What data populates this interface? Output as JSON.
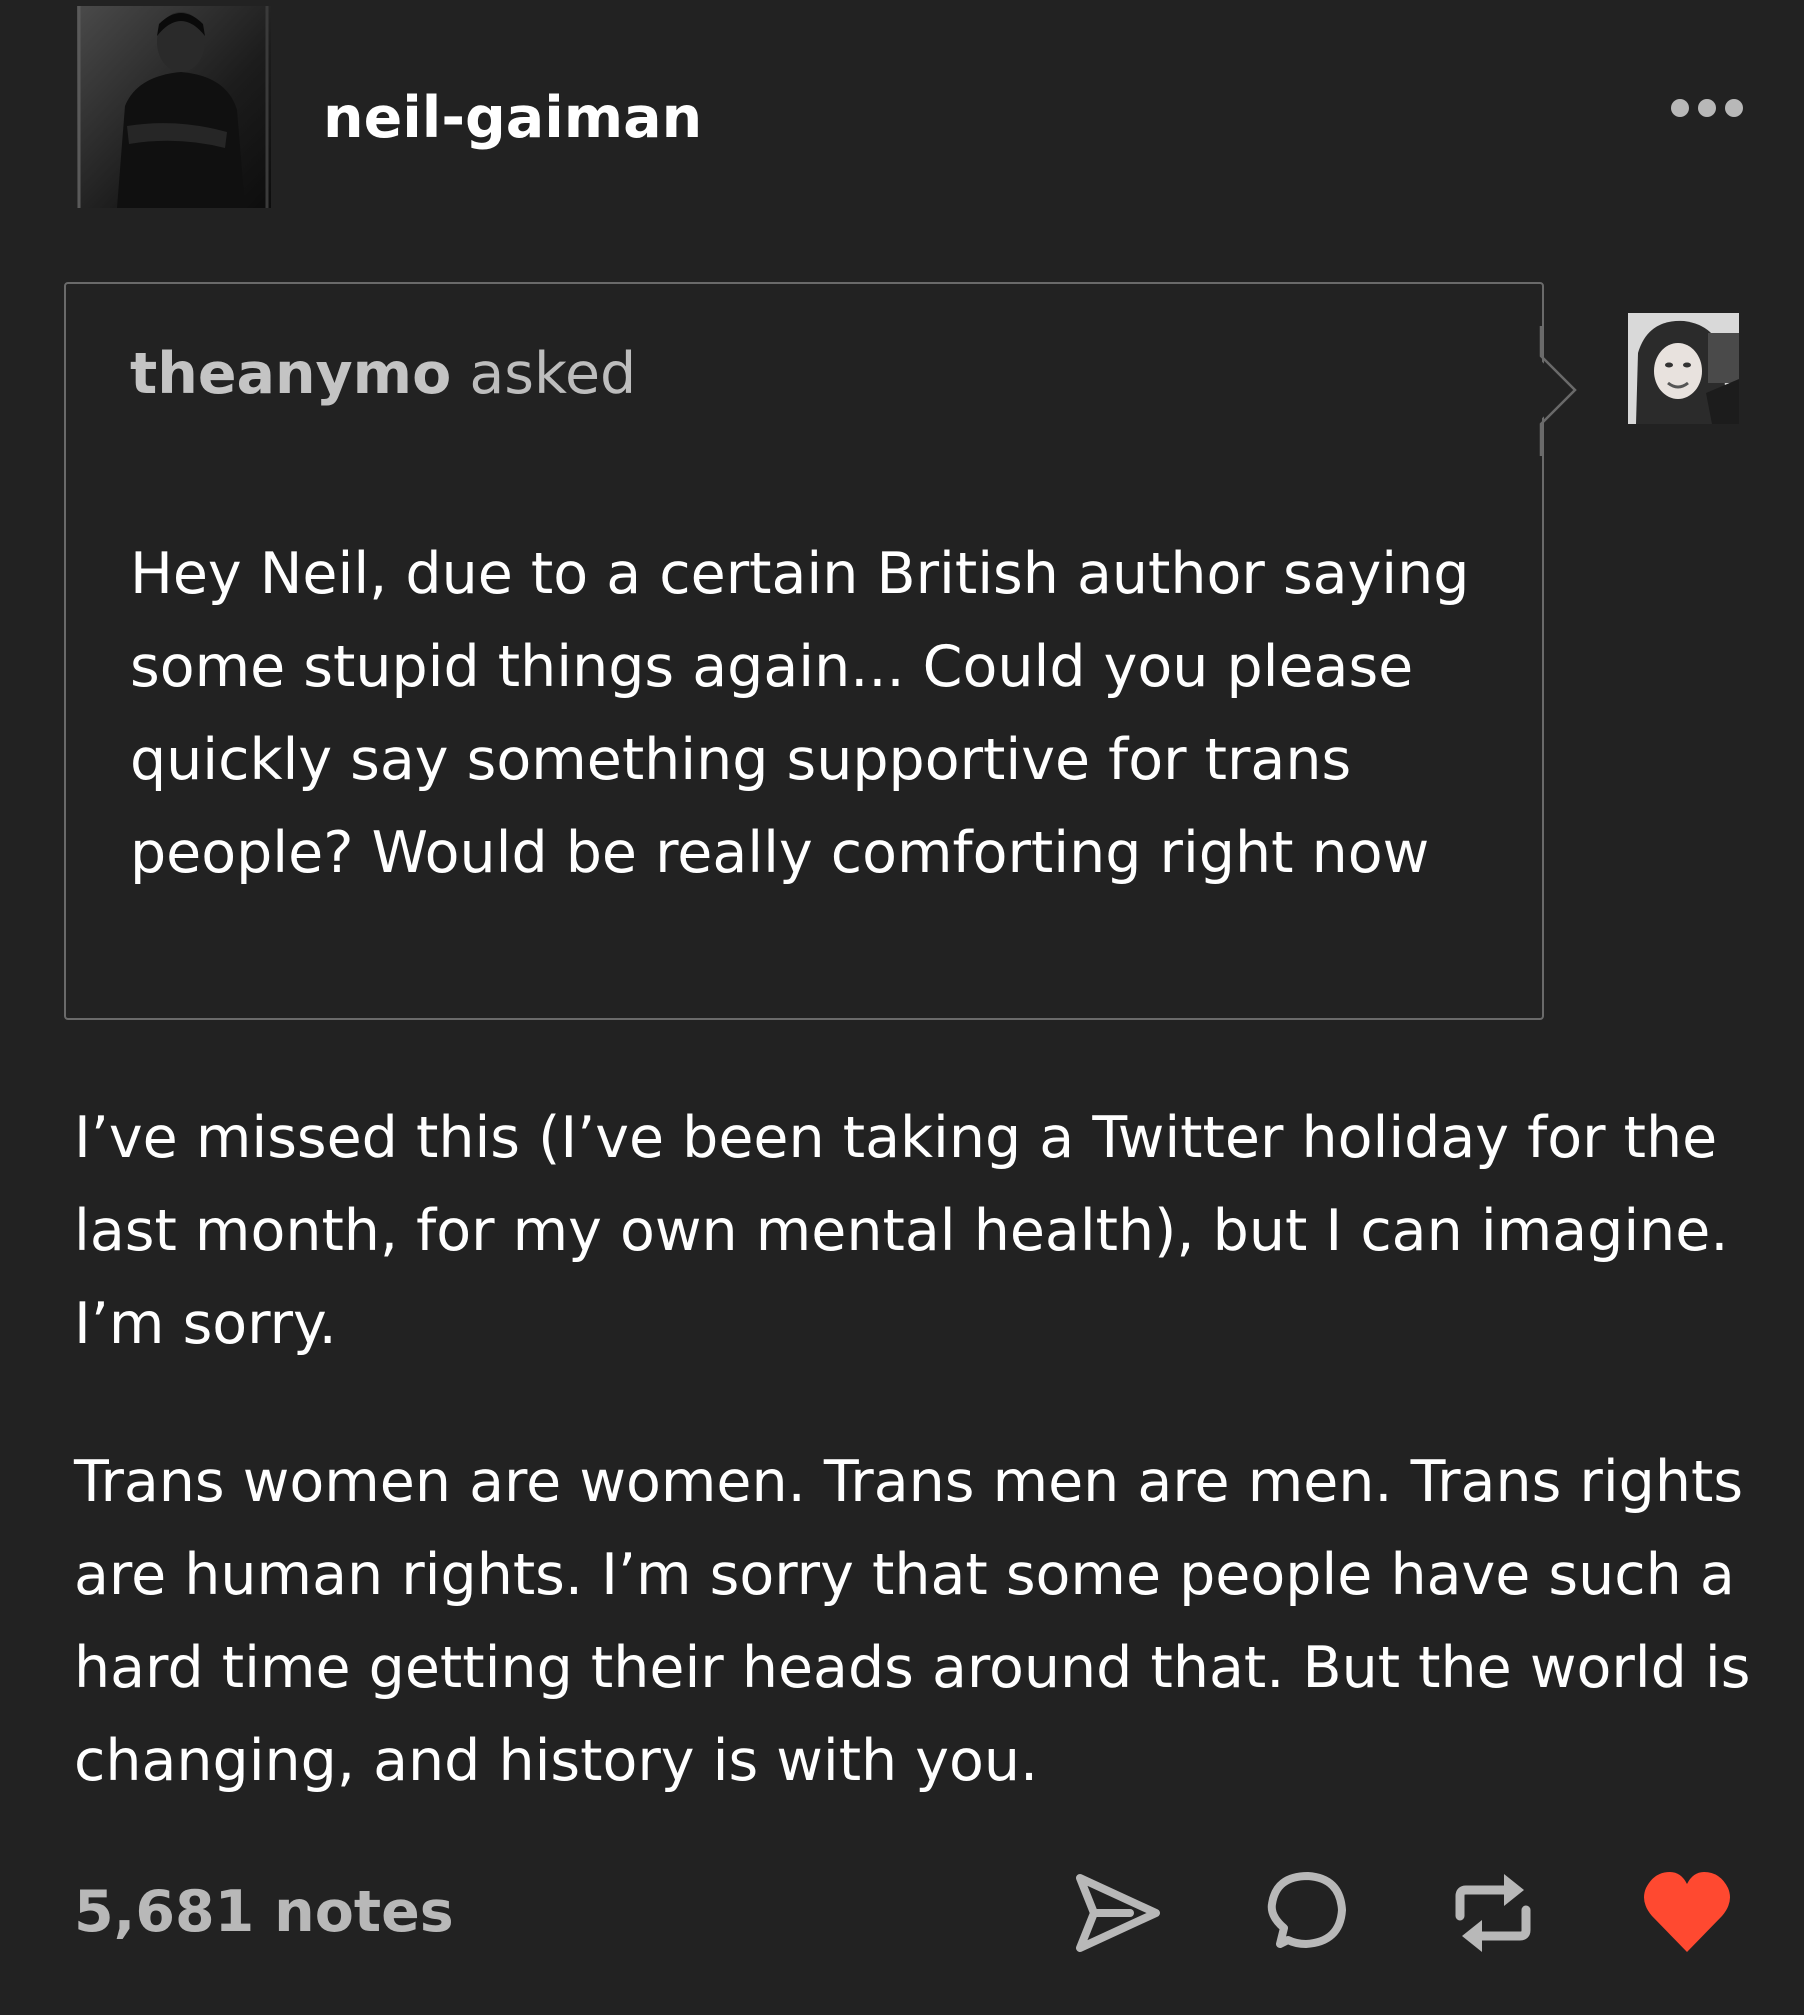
{
  "post": {
    "blog_name": "neil-gaiman",
    "ask": {
      "asker": "theanymo",
      "verb": "asked",
      "question": "Hey Neil, due to a certain British author saying some stupid things again... Could you please quickly say something supportive for trans people? Would be really comforting right now"
    },
    "answer": [
      "I’ve missed this (I’ve been taking a Twitter holiday for the last month, for my own mental health), but I can imagine. I’m sorry.",
      "Trans women are women. Trans men are men.  Trans rights are human rights. I’m sorry that some people have such a hard time getting their heads around that. But the world is changing, and history is with you."
    ],
    "footer": {
      "notes": "5,681 notes",
      "actions": [
        "share-icon",
        "reply-icon",
        "reblog-icon",
        "like-icon"
      ],
      "like_color": "#ff4930"
    }
  },
  "theme": {
    "background": "#222222",
    "text": "#ffffff",
    "muted": "#b8b8b8",
    "border": "#6a6a6a"
  }
}
